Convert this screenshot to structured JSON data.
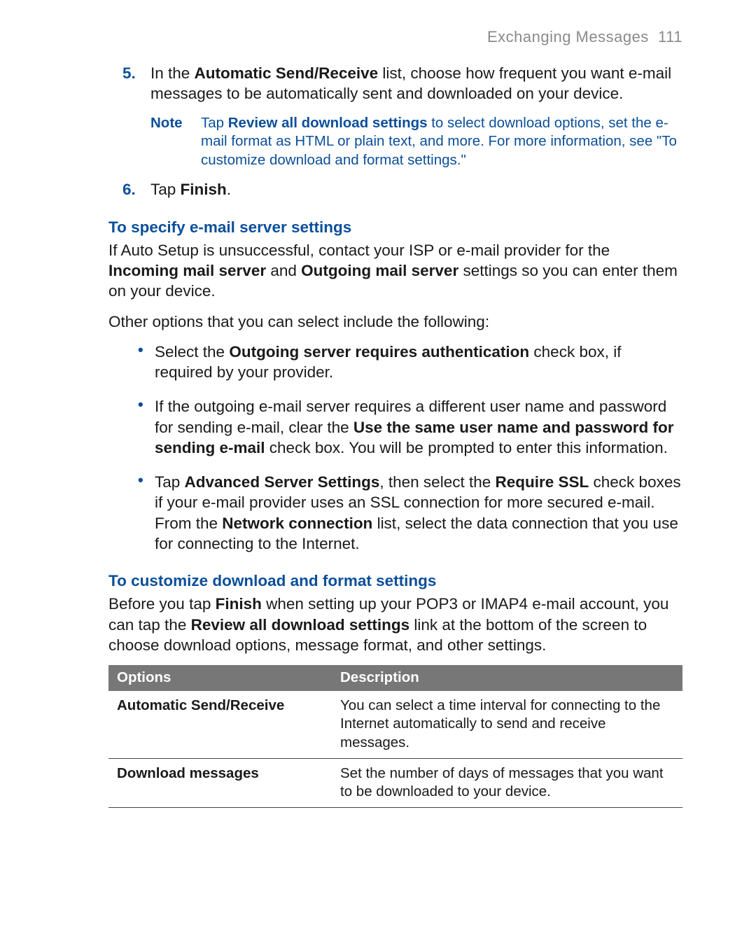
{
  "header": {
    "section_title": "Exchanging Messages",
    "page_number": "111"
  },
  "step5": {
    "number": "5.",
    "pre": "In the ",
    "bold": "Automatic Send/Receive",
    "post": " list, choose how frequent you want e-mail messages to be automatically sent and downloaded on your device."
  },
  "note": {
    "label": "Note",
    "pre": "Tap ",
    "bold": "Review all download settings",
    "post": " to select download options, set the e-mail format as HTML or plain text, and more. For more information, see \"To customize download and format settings.\""
  },
  "step6": {
    "number": "6.",
    "pre": "Tap ",
    "bold": "Finish",
    "post": "."
  },
  "section_server": {
    "heading": "To specify e-mail server settings",
    "p1_pre": "If Auto Setup is unsuccessful, contact your ISP or e-mail provider for the ",
    "p1_b1": "Incoming mail server",
    "p1_mid": " and ",
    "p1_b2": "Outgoing mail server",
    "p1_post": " settings so you can enter them on your device.",
    "p2": "Other options that you can select include the following:",
    "bullet1_pre": "Select the ",
    "bullet1_b": "Outgoing server requires authentication",
    "bullet1_post": " check box, if required by your provider.",
    "bullet2_pre": "If the outgoing e-mail server requires a different user name and password for sending e-mail, clear the ",
    "bullet2_b": "Use the same user name and password for sending e-mail",
    "bullet2_post": " check box. You will be prompted to enter this information.",
    "bullet3_pre": "Tap ",
    "bullet3_b1": "Advanced Server Settings",
    "bullet3_mid1": ", then select the ",
    "bullet3_b2": "Require SSL",
    "bullet3_mid2": " check boxes if your e-mail provider uses an SSL connection for more secured e-mail. From the ",
    "bullet3_b3": "Network connection",
    "bullet3_post": " list, select the data connection that you use for connecting to the Internet."
  },
  "section_custom": {
    "heading": "To customize download and format settings",
    "p_pre": "Before you tap ",
    "p_b1": "Finish",
    "p_mid": " when setting up your POP3 or IMAP4 e-mail account, you can tap the ",
    "p_b2": "Review all download settings",
    "p_post": " link at the bottom of the screen to choose download options, message format, and other settings."
  },
  "table": {
    "h1": "Options",
    "h2": "Description",
    "rows": [
      {
        "opt": "Automatic Send/Receive",
        "desc": "You can select a time interval for connecting to the Internet automatically to send and receive messages."
      },
      {
        "opt": "Download messages",
        "desc": "Set the number of days of messages that you want to be downloaded to your device."
      }
    ]
  }
}
